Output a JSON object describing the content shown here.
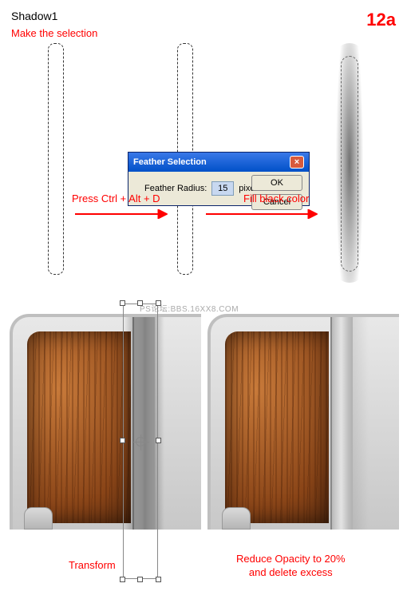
{
  "header": {
    "title": "Shadow1",
    "step": "12a"
  },
  "sub": "Make the selection",
  "dialog": {
    "title": "Feather Selection",
    "label": "Feather Radius:",
    "value": "15",
    "unit": "pixels",
    "ok": "OK",
    "cancel": "Cancel"
  },
  "cap1": "Press Ctrl + Alt + D",
  "cap2": "Fill black color",
  "watermark": "PS论坛:BBS.16XX8.COM",
  "bcap1": "Transform",
  "bcap2a": "Reduce Opacity to 20%",
  "bcap2b": "and delete excess"
}
